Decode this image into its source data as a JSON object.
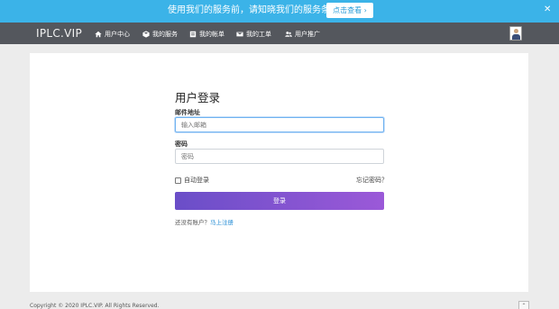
{
  "notice": {
    "text": "使用我们的服务前，请知晓我们的服务条款.",
    "button_label": "点击查看 ›",
    "close_glyph": "✕",
    "bg_color": "#3bb3e8"
  },
  "navbar": {
    "brand": "IPLC.VIP",
    "bg_color": "#54575d",
    "items": [
      {
        "label": "用户中心",
        "icon": "home-icon"
      },
      {
        "label": "我的服务",
        "icon": "cube-icon"
      },
      {
        "label": "我的帐单",
        "icon": "billing-icon"
      },
      {
        "label": "我的工单",
        "icon": "ticket-icon"
      },
      {
        "label": "用户推广",
        "icon": "users-icon"
      }
    ],
    "avatar_icon": "user-avatar-icon"
  },
  "login": {
    "title": "用户登录",
    "email_label": "邮件地址",
    "email_placeholder": "输入邮箱",
    "password_label": "密码",
    "password_placeholder": "密码",
    "remember_label": "自动登录",
    "forgot_label": "忘记密码？",
    "submit_label": "登录",
    "register_prompt": "还没有账户？",
    "register_link": "马上注册",
    "button_gradient": [
      "#6a4ec8",
      "#9b59d8"
    ]
  },
  "footer": {
    "copyright": "Copyright © 2020 IPLC.VIP. All Rights Reserved.",
    "to_top_glyph": "⌃"
  }
}
